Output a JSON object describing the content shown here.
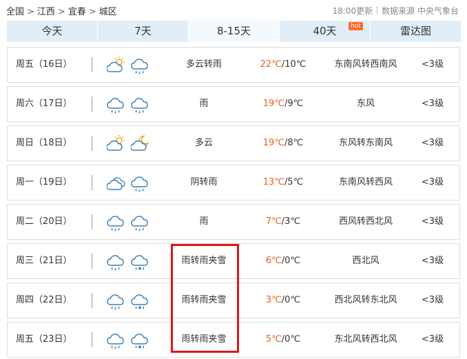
{
  "breadcrumb": {
    "items": [
      "全国",
      "江西",
      "宜春",
      "城区"
    ],
    "separator": ">"
  },
  "header_meta": {
    "update_time": "18:00更新",
    "source": "数据来源 中央气象台"
  },
  "tabs": [
    {
      "label": "今天"
    },
    {
      "label": "7天"
    },
    {
      "label": "8-15天",
      "active": true
    },
    {
      "label": "40天",
      "badge": "hot"
    },
    {
      "label": "雷达图"
    }
  ],
  "colors": {
    "high_temp": "#e8611b",
    "tab_bg": "#e1eef8",
    "highlight_border": "#e0151b"
  },
  "forecast": [
    {
      "day": "周五（16日）",
      "icons": [
        "partly-cloudy-icon",
        "rain-icon"
      ],
      "weather": "多云转雨",
      "high": "22℃",
      "low": "/10℃",
      "wind": "东南风转西南风",
      "level": "<3级"
    },
    {
      "day": "周六（17日）",
      "icons": [
        "rain-icon",
        "rain-icon"
      ],
      "weather": "雨",
      "high": "19℃",
      "low": "/9℃",
      "wind": "东风",
      "level": "<3级"
    },
    {
      "day": "周日（18日）",
      "icons": [
        "partly-cloudy-icon",
        "cloudy-night-icon"
      ],
      "weather": "多云",
      "high": "19℃",
      "low": "/8℃",
      "wind": "东风转东南风",
      "level": "<3级"
    },
    {
      "day": "周一（19日）",
      "icons": [
        "overcast-icon",
        "rain-icon"
      ],
      "weather": "阴转雨",
      "high": "13℃",
      "low": "/5℃",
      "wind": "东南风转西风",
      "level": "<3级"
    },
    {
      "day": "周二（20日）",
      "icons": [
        "rain-icon",
        "rain-icon"
      ],
      "weather": "雨",
      "high": "7℃",
      "low": "/3℃",
      "wind": "西风转西北风",
      "level": "<3级"
    },
    {
      "day": "周三（21日）",
      "icons": [
        "rain-icon",
        "sleet-icon"
      ],
      "weather": "雨转雨夹雪",
      "high": "6℃",
      "low": "/0℃",
      "wind": "西北风",
      "level": "<3级"
    },
    {
      "day": "周四（22日）",
      "icons": [
        "rain-icon",
        "sleet-icon"
      ],
      "weather": "雨转雨夹雪",
      "high": "3℃",
      "low": "/0℃",
      "wind": "西北风转东北风",
      "level": "<3级"
    },
    {
      "day": "周五（23日）",
      "icons": [
        "rain-icon",
        "sleet-icon"
      ],
      "weather": "雨转雨夹雪",
      "high": "5℃",
      "low": "/0℃",
      "wind": "东北风转西北风",
      "level": "<3级"
    }
  ]
}
